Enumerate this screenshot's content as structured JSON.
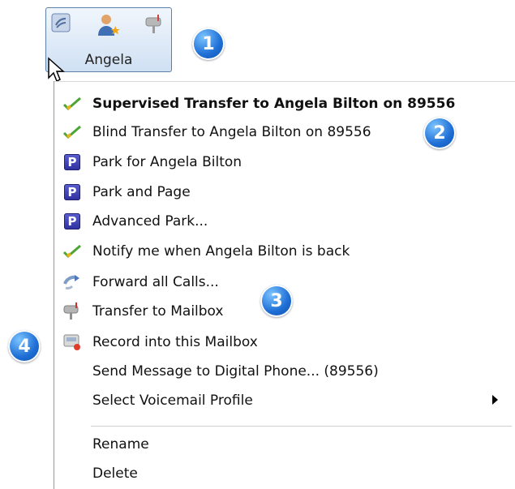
{
  "tile": {
    "name": "Angela"
  },
  "callouts": [
    "1",
    "2",
    "3",
    "4"
  ],
  "menu": {
    "items": [
      {
        "label": "Supervised Transfer to Angela Bilton on 89556",
        "icon": "transfer-check-icon"
      },
      {
        "label": "Blind Transfer to Angela Bilton on 89556",
        "icon": "transfer-check-icon"
      },
      {
        "label": "Park for Angela Bilton",
        "icon": "park-icon"
      },
      {
        "label": "Park and Page",
        "icon": "park-icon"
      },
      {
        "label": "Advanced Park...",
        "icon": "park-icon"
      },
      {
        "label": "Notify me when Angela Bilton is back",
        "icon": "transfer-check-icon"
      },
      {
        "label": "Forward all Calls...",
        "icon": "forward-icon"
      },
      {
        "label": "Transfer to Mailbox",
        "icon": "mailbox-icon"
      },
      {
        "label": "Record into this Mailbox",
        "icon": "record-icon"
      },
      {
        "label": "Send Message to Digital Phone... (89556)",
        "icon": ""
      },
      {
        "label": "Select Voicemail Profile",
        "icon": ""
      },
      {
        "label": "Rename",
        "icon": ""
      },
      {
        "label": "Delete",
        "icon": ""
      }
    ],
    "park_letter": "P"
  },
  "colors": {
    "badge": "#1f6fd6",
    "park": "#3a3aae",
    "separator": "#9a9a9a"
  }
}
